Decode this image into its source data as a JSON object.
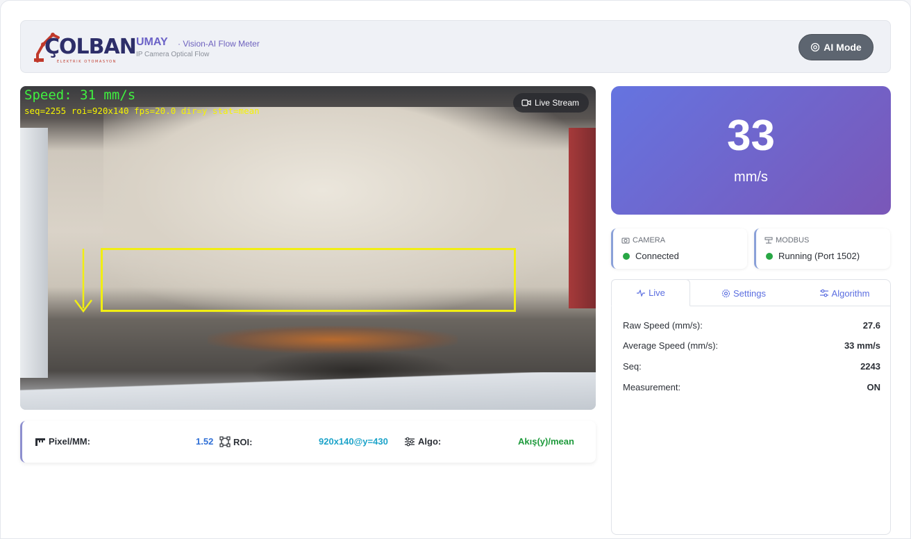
{
  "header": {
    "logo_text": "ÇOLBAN",
    "logo_sub": "ELEKTRIK OTOMASYON",
    "title": "UMAY",
    "subtitle": "· Vision-AI Flow Meter",
    "description": "IP Camera Optical Flow",
    "ai_mode_label": "AI Mode"
  },
  "video": {
    "overlay_speed": "Speed: 31 mm/s",
    "overlay_info": "seq=2255 roi=920x140 fps=20.0 dir=y stat=mean",
    "badge": "Live Stream"
  },
  "params": {
    "pixel_label": "Pixel/MM:",
    "pixel_value": "1.52",
    "roi_label": "ROI:",
    "roi_value": "920x140@y=430",
    "algo_label": "Algo:",
    "algo_value": "Akış(y)/mean"
  },
  "speed": {
    "value": "33",
    "unit": "mm/s"
  },
  "status": {
    "camera_label": "CAMERA",
    "camera_value": "Connected",
    "modbus_label": "MODBUS",
    "modbus_value": "Running (Port 1502)"
  },
  "tabs": [
    {
      "label": "Live"
    },
    {
      "label": "Settings"
    },
    {
      "label": "Algorithm"
    }
  ],
  "live": {
    "rows": [
      {
        "label": "Raw Speed (mm/s):",
        "value": "27.6"
      },
      {
        "label": "Average Speed (mm/s):",
        "value": "33 mm/s"
      },
      {
        "label": "Seq:",
        "value": "2243"
      },
      {
        "label": "Measurement:",
        "value": "ON"
      }
    ]
  },
  "colors": {
    "accent": "#5b6ee0",
    "status_ok": "#28a745",
    "pixel_value": "#2f6fd6",
    "roi_value": "#1ca3c9",
    "algo_value": "#1e9a3c"
  }
}
